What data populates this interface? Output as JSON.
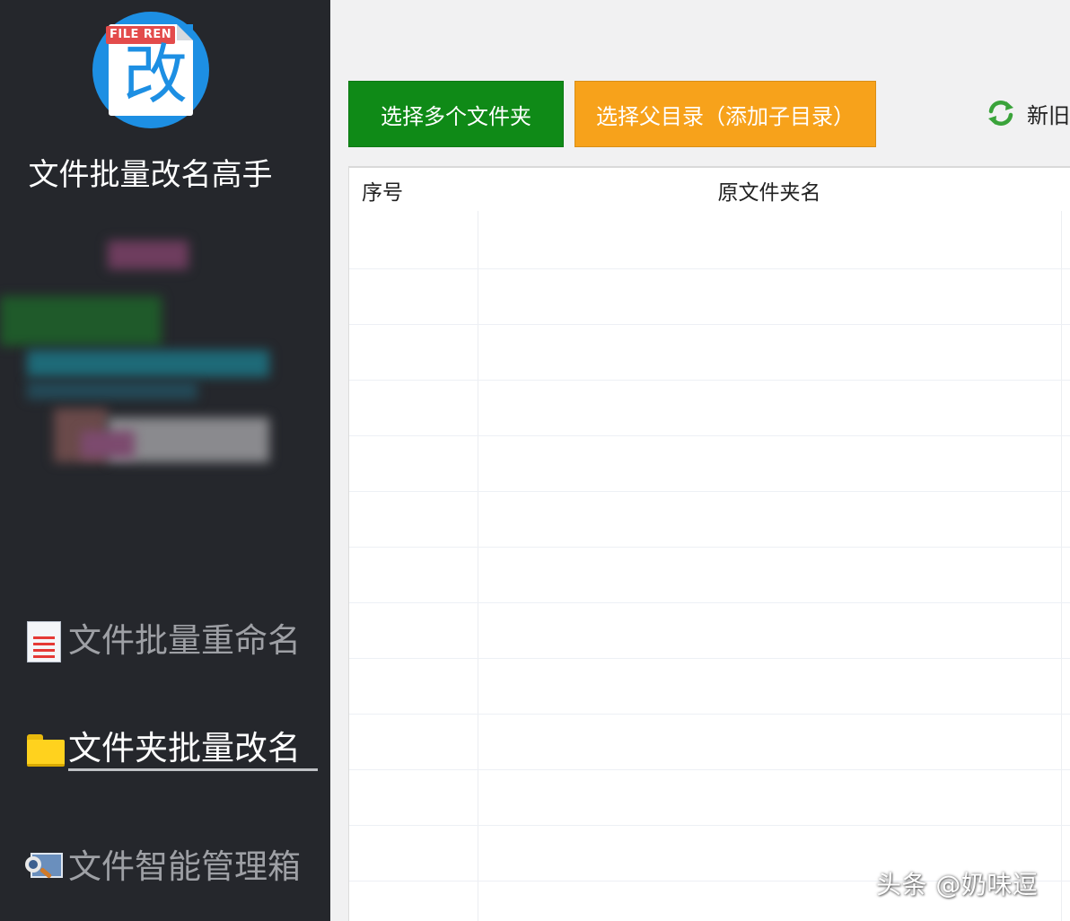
{
  "app": {
    "logo_tag": "FILE REN",
    "logo_char": "改",
    "title": "文件批量改名高手"
  },
  "sidebar": {
    "items": [
      {
        "label": "文件批量重命名",
        "icon": "document-list-icon",
        "active": false
      },
      {
        "label": "文件夹批量改名",
        "icon": "folder-icon",
        "active": true
      },
      {
        "label": "文件智能管理箱",
        "icon": "image-search-icon",
        "active": false
      }
    ]
  },
  "toolbar": {
    "select_folders_label": "选择多个文件夹",
    "select_parent_label": "选择父目录（添加子目录）",
    "refresh_label": "新旧",
    "colors": {
      "green": "#0f8a17",
      "orange": "#f7a21b"
    }
  },
  "table": {
    "columns": [
      "序号",
      "原文件夹名"
    ],
    "rows": []
  },
  "watermark": "头条 @奶味逗"
}
